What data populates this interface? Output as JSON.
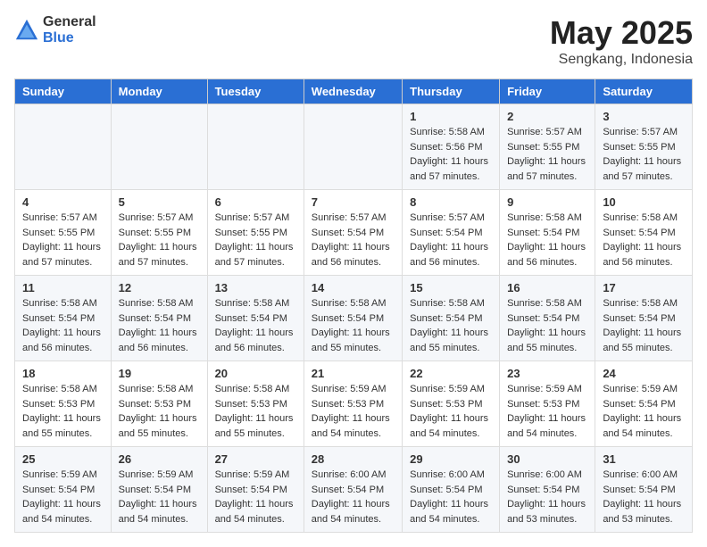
{
  "header": {
    "logo_general": "General",
    "logo_blue": "Blue",
    "title": "May 2025",
    "subtitle": "Sengkang, Indonesia"
  },
  "weekdays": [
    "Sunday",
    "Monday",
    "Tuesday",
    "Wednesday",
    "Thursday",
    "Friday",
    "Saturday"
  ],
  "weeks": [
    [
      {
        "day": "",
        "info": ""
      },
      {
        "day": "",
        "info": ""
      },
      {
        "day": "",
        "info": ""
      },
      {
        "day": "",
        "info": ""
      },
      {
        "day": "1",
        "info": "Sunrise: 5:58 AM\nSunset: 5:56 PM\nDaylight: 11 hours\nand 57 minutes."
      },
      {
        "day": "2",
        "info": "Sunrise: 5:57 AM\nSunset: 5:55 PM\nDaylight: 11 hours\nand 57 minutes."
      },
      {
        "day": "3",
        "info": "Sunrise: 5:57 AM\nSunset: 5:55 PM\nDaylight: 11 hours\nand 57 minutes."
      }
    ],
    [
      {
        "day": "4",
        "info": "Sunrise: 5:57 AM\nSunset: 5:55 PM\nDaylight: 11 hours\nand 57 minutes."
      },
      {
        "day": "5",
        "info": "Sunrise: 5:57 AM\nSunset: 5:55 PM\nDaylight: 11 hours\nand 57 minutes."
      },
      {
        "day": "6",
        "info": "Sunrise: 5:57 AM\nSunset: 5:55 PM\nDaylight: 11 hours\nand 57 minutes."
      },
      {
        "day": "7",
        "info": "Sunrise: 5:57 AM\nSunset: 5:54 PM\nDaylight: 11 hours\nand 56 minutes."
      },
      {
        "day": "8",
        "info": "Sunrise: 5:57 AM\nSunset: 5:54 PM\nDaylight: 11 hours\nand 56 minutes."
      },
      {
        "day": "9",
        "info": "Sunrise: 5:58 AM\nSunset: 5:54 PM\nDaylight: 11 hours\nand 56 minutes."
      },
      {
        "day": "10",
        "info": "Sunrise: 5:58 AM\nSunset: 5:54 PM\nDaylight: 11 hours\nand 56 minutes."
      }
    ],
    [
      {
        "day": "11",
        "info": "Sunrise: 5:58 AM\nSunset: 5:54 PM\nDaylight: 11 hours\nand 56 minutes."
      },
      {
        "day": "12",
        "info": "Sunrise: 5:58 AM\nSunset: 5:54 PM\nDaylight: 11 hours\nand 56 minutes."
      },
      {
        "day": "13",
        "info": "Sunrise: 5:58 AM\nSunset: 5:54 PM\nDaylight: 11 hours\nand 56 minutes."
      },
      {
        "day": "14",
        "info": "Sunrise: 5:58 AM\nSunset: 5:54 PM\nDaylight: 11 hours\nand 55 minutes."
      },
      {
        "day": "15",
        "info": "Sunrise: 5:58 AM\nSunset: 5:54 PM\nDaylight: 11 hours\nand 55 minutes."
      },
      {
        "day": "16",
        "info": "Sunrise: 5:58 AM\nSunset: 5:54 PM\nDaylight: 11 hours\nand 55 minutes."
      },
      {
        "day": "17",
        "info": "Sunrise: 5:58 AM\nSunset: 5:54 PM\nDaylight: 11 hours\nand 55 minutes."
      }
    ],
    [
      {
        "day": "18",
        "info": "Sunrise: 5:58 AM\nSunset: 5:53 PM\nDaylight: 11 hours\nand 55 minutes."
      },
      {
        "day": "19",
        "info": "Sunrise: 5:58 AM\nSunset: 5:53 PM\nDaylight: 11 hours\nand 55 minutes."
      },
      {
        "day": "20",
        "info": "Sunrise: 5:58 AM\nSunset: 5:53 PM\nDaylight: 11 hours\nand 55 minutes."
      },
      {
        "day": "21",
        "info": "Sunrise: 5:59 AM\nSunset: 5:53 PM\nDaylight: 11 hours\nand 54 minutes."
      },
      {
        "day": "22",
        "info": "Sunrise: 5:59 AM\nSunset: 5:53 PM\nDaylight: 11 hours\nand 54 minutes."
      },
      {
        "day": "23",
        "info": "Sunrise: 5:59 AM\nSunset: 5:53 PM\nDaylight: 11 hours\nand 54 minutes."
      },
      {
        "day": "24",
        "info": "Sunrise: 5:59 AM\nSunset: 5:54 PM\nDaylight: 11 hours\nand 54 minutes."
      }
    ],
    [
      {
        "day": "25",
        "info": "Sunrise: 5:59 AM\nSunset: 5:54 PM\nDaylight: 11 hours\nand 54 minutes."
      },
      {
        "day": "26",
        "info": "Sunrise: 5:59 AM\nSunset: 5:54 PM\nDaylight: 11 hours\nand 54 minutes."
      },
      {
        "day": "27",
        "info": "Sunrise: 5:59 AM\nSunset: 5:54 PM\nDaylight: 11 hours\nand 54 minutes."
      },
      {
        "day": "28",
        "info": "Sunrise: 6:00 AM\nSunset: 5:54 PM\nDaylight: 11 hours\nand 54 minutes."
      },
      {
        "day": "29",
        "info": "Sunrise: 6:00 AM\nSunset: 5:54 PM\nDaylight: 11 hours\nand 54 minutes."
      },
      {
        "day": "30",
        "info": "Sunrise: 6:00 AM\nSunset: 5:54 PM\nDaylight: 11 hours\nand 53 minutes."
      },
      {
        "day": "31",
        "info": "Sunrise: 6:00 AM\nSunset: 5:54 PM\nDaylight: 11 hours\nand 53 minutes."
      }
    ]
  ]
}
